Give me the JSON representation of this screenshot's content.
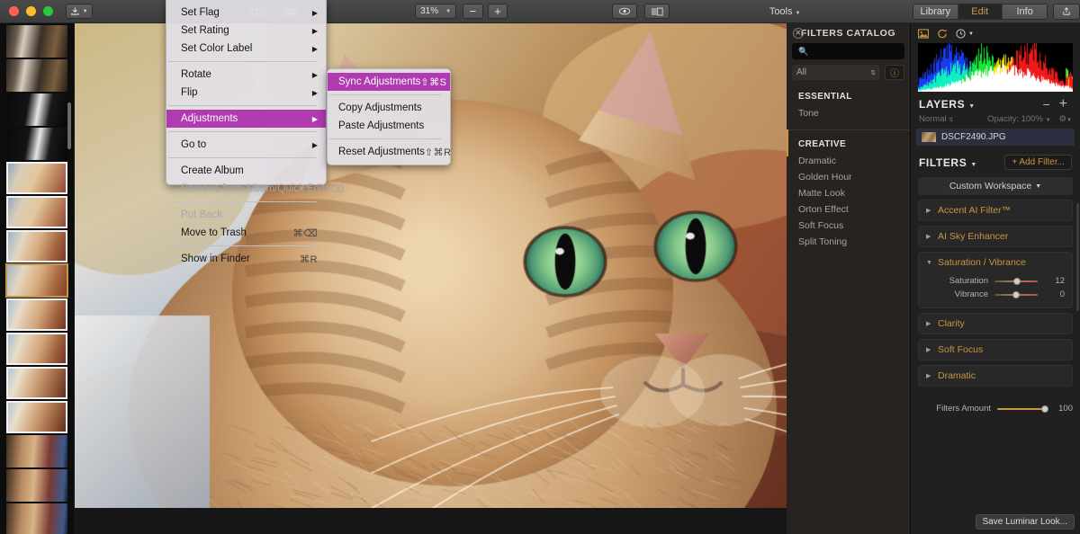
{
  "window": {
    "traffic_lights": [
      "close",
      "minimize",
      "zoom"
    ]
  },
  "toolbar": {
    "export_icon": "export-icon",
    "crop_icon": "crop-icon",
    "compare_icon": "compare-icon",
    "zoom_level": "31%",
    "zoom_out": "−",
    "zoom_in": "+",
    "eye_icon": "eye-icon",
    "before_after_icon": "before-after-icon",
    "tools_label": "Tools",
    "tabs": [
      {
        "label": "Library",
        "active": false
      },
      {
        "label": "Edit",
        "active": true
      },
      {
        "label": "Info",
        "active": false
      }
    ],
    "share_icon": "share-icon"
  },
  "catalog": {
    "title": "FILTERS CATALOG",
    "close_icon": "close-icon",
    "search_icon": "search-icon",
    "search_value": "",
    "search_placeholder": "",
    "search_clear_icon": "clear-icon",
    "dropdown_value": "All",
    "info_icon": "info-icon",
    "groups": [
      {
        "title": "ESSENTIAL",
        "items": [
          "Tone"
        ]
      },
      {
        "title": "CREATIVE",
        "items": [
          "Dramatic",
          "Golden Hour",
          "Matte Look",
          "Orton Effect",
          "Soft Focus",
          "Split Toning"
        ]
      }
    ]
  },
  "context_menu": {
    "items": [
      {
        "label": "Set Flag",
        "submenu": true,
        "shortcut": "",
        "disabled": false,
        "highlighted": false
      },
      {
        "label": "Set Rating",
        "submenu": true,
        "shortcut": "",
        "disabled": false,
        "highlighted": false
      },
      {
        "label": "Set Color Label",
        "submenu": true,
        "shortcut": "",
        "disabled": false,
        "highlighted": false
      },
      {
        "separator": true
      },
      {
        "label": "Rotate",
        "submenu": true,
        "shortcut": "",
        "disabled": false,
        "highlighted": false
      },
      {
        "label": "Flip",
        "submenu": true,
        "shortcut": "",
        "disabled": false,
        "highlighted": false
      },
      {
        "separator": true
      },
      {
        "label": "Adjustments",
        "submenu": true,
        "shortcut": "",
        "disabled": false,
        "highlighted": true
      },
      {
        "separator": true
      },
      {
        "label": "Go to",
        "submenu": true,
        "shortcut": "",
        "disabled": false,
        "highlighted": false
      },
      {
        "separator": true
      },
      {
        "label": "Create Album",
        "submenu": false,
        "shortcut": "",
        "disabled": false,
        "highlighted": false
      },
      {
        "label": "Remove from Album/Quick Edits",
        "submenu": false,
        "shortcut": "⌫",
        "disabled": true,
        "highlighted": false
      },
      {
        "separator": true
      },
      {
        "label": "Put Back",
        "submenu": false,
        "shortcut": "",
        "disabled": true,
        "highlighted": false
      },
      {
        "label": "Move to Trash",
        "submenu": false,
        "shortcut": "⌘⌫",
        "disabled": false,
        "highlighted": false
      },
      {
        "separator": true
      },
      {
        "label": "Show in Finder",
        "submenu": false,
        "shortcut": "⌘R",
        "disabled": false,
        "highlighted": false
      }
    ]
  },
  "submenu": {
    "items": [
      {
        "label": "Sync Adjustments",
        "shortcut": "⇧⌘S",
        "highlighted": true
      },
      {
        "separator": true
      },
      {
        "label": "Copy Adjustments",
        "shortcut": "",
        "highlighted": false
      },
      {
        "label": "Paste Adjustments",
        "shortcut": "",
        "highlighted": false
      },
      {
        "separator": true
      },
      {
        "label": "Reset Adjustments",
        "shortcut": "⇧⌘R",
        "highlighted": false
      }
    ]
  },
  "right_panel": {
    "histogram_icons": [
      "image-histogram-icon",
      "refresh-icon",
      "clock-icon"
    ],
    "layers": {
      "title": "LAYERS",
      "minus_label": "−",
      "plus_label": "+",
      "blend_mode": "Normal",
      "opacity_label": "Opacity: 100%",
      "gear_icon": "gear-icon",
      "items": [
        {
          "name": "DSCF2490.JPG"
        }
      ]
    },
    "filters": {
      "title": "FILTERS",
      "add_filter_label": "+ Add Filter...",
      "workspace": "Custom Workspace",
      "list": [
        {
          "name": "Accent AI Filter™",
          "expanded": false
        },
        {
          "name": "AI Sky Enhancer",
          "expanded": false
        },
        {
          "name": "Saturation / Vibrance",
          "expanded": true,
          "sliders": [
            {
              "label": "Saturation",
              "value": 12,
              "pos_pct": 52
            },
            {
              "label": "Vibrance",
              "value": 0,
              "pos_pct": 50
            }
          ]
        },
        {
          "name": "Clarity",
          "expanded": false
        },
        {
          "name": "Soft Focus",
          "expanded": false
        },
        {
          "name": "Dramatic",
          "expanded": false
        }
      ],
      "amount": {
        "label": "Filters Amount",
        "value": 100,
        "pos_pct": 100
      }
    },
    "save_look_label": "Save Luminar Look..."
  },
  "accent_color": "#c89541",
  "highlight_color": "#b03ab0"
}
